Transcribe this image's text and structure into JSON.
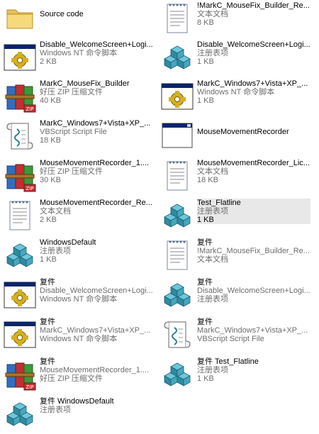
{
  "files": [
    {
      "name": "Source code",
      "type": "",
      "size": "",
      "icon": "folder-icon"
    },
    {
      "name": "!MarkC_MouseFix_Builder_Re...",
      "type": "文本文档",
      "size": "8 KB",
      "icon": "text-document-icon"
    },
    {
      "name": "Disable_WelcomeScreen+Logi...",
      "type": "Windows NT 命令脚本",
      "size": "2 KB",
      "icon": "command-script-icon"
    },
    {
      "name": "Disable_WelcomeScreen+Logi...",
      "type": "注册表项",
      "size": "1 KB",
      "icon": "registry-file-icon"
    },
    {
      "name": "MarkC_MouseFix_Builder",
      "type": "好压 ZIP 压缩文件",
      "size": "40 KB",
      "icon": "zip-archive-icon"
    },
    {
      "name": "MarkC_Windows7+Vista+XP_...",
      "type": "Windows NT 命令脚本",
      "size": "1 KB",
      "icon": "command-script-icon"
    },
    {
      "name": "MarkC_Windows7+Vista+XP_...",
      "type": "VBScript Script File",
      "size": "18 KB",
      "icon": "vbscript-file-icon"
    },
    {
      "name": "MouseMovementRecorder",
      "type": "",
      "size": "",
      "icon": "application-window-icon"
    },
    {
      "name": "MouseMovementRecorder_1....",
      "type": "好压 ZIP 压缩文件",
      "size": "30 KB",
      "icon": "zip-archive-icon"
    },
    {
      "name": "MouseMovementRecorder_Lic...",
      "type": "文本文档",
      "size": "18 KB",
      "icon": "text-document-icon"
    },
    {
      "name": "MouseMovementRecorder_Re...",
      "type": "文本文档",
      "size": "2 KB",
      "icon": "text-document-icon"
    },
    {
      "name": "Test_Flatline",
      "type": "注册表项",
      "size": "1 KB",
      "icon": "registry-file-icon",
      "selected": true
    },
    {
      "name": "WindowsDefault",
      "type": "注册表项",
      "size": "1 KB",
      "icon": "registry-file-icon"
    },
    {
      "name": "复件",
      "type": "!MarkC_MouseFix_Builder_Re...",
      "size": "文本文档",
      "icon": "text-document-icon"
    },
    {
      "name": "复件",
      "type": "Disable_WelcomeScreen+Logi...",
      "size": "Windows NT 命令脚本",
      "icon": "command-script-icon"
    },
    {
      "name": "复件",
      "type": "Disable_WelcomeScreen+Logi...",
      "size": "注册表项",
      "icon": "registry-file-icon"
    },
    {
      "name": "复件",
      "type": "MarkC_Windows7+Vista+XP_...",
      "size": "Windows NT 命令脚本",
      "icon": "command-script-icon"
    },
    {
      "name": "复件",
      "type": "MarkC_Windows7+Vista+XP_...",
      "size": "VBScript Script File",
      "icon": "vbscript-file-icon"
    },
    {
      "name": "复件",
      "type": "MouseMovementRecorder_1....",
      "size": "好压 ZIP 压缩文件",
      "icon": "zip-archive-icon"
    },
    {
      "name": "复件 Test_Flatline",
      "type": "注册表项",
      "size": "1 KB",
      "icon": "registry-file-icon"
    },
    {
      "name": "复件 WindowsDefault",
      "type": "注册表项",
      "size": "",
      "icon": "registry-file-icon"
    }
  ]
}
